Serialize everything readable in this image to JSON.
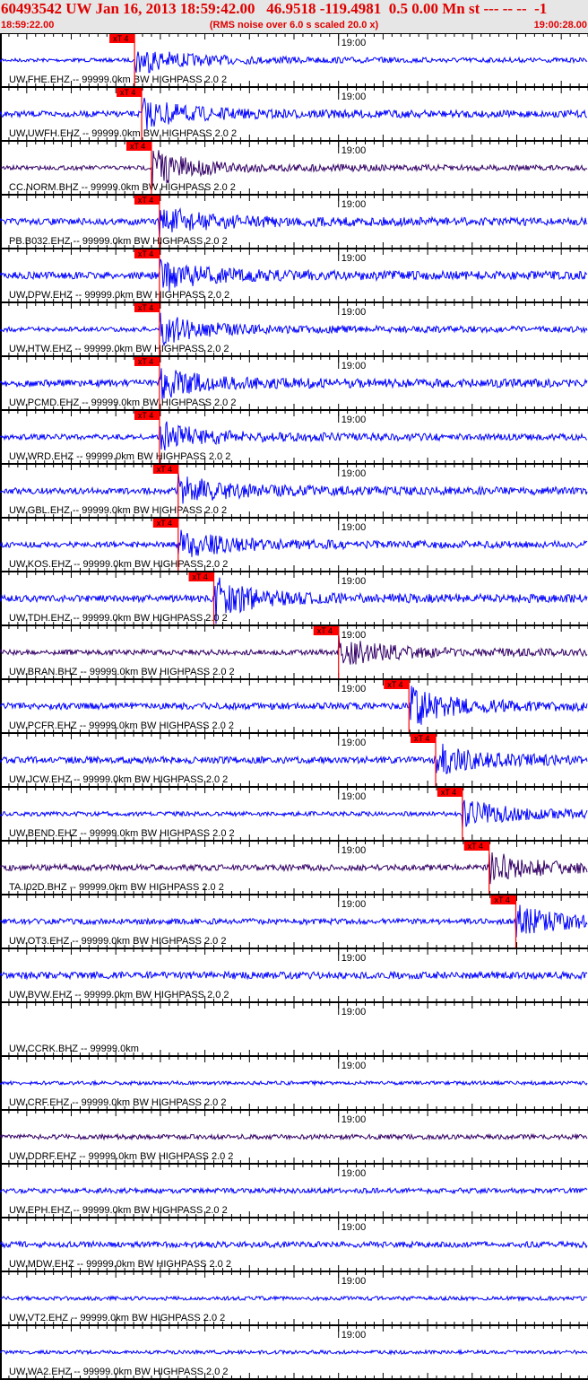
{
  "header": {
    "title": "60493542 UW Jan 16, 2013 18:59:42.00   46.9518 -119.4981  0.5 0.00 Mn st --- -- --  -1",
    "start_time": "18:59:22.00",
    "note": "(RMS noise over 6.0 s scaled 20.0 x)",
    "end_time": "19:00:28.00"
  },
  "chart_data": {
    "type": "line",
    "time_range_s": [
      0,
      66
    ],
    "tick_label": "19:00",
    "tick_label_time_s": 38,
    "pick_label": "xT 4",
    "colors": {
      "trace": "#0000ff",
      "trace_dark": "#330066",
      "pick": "#ff0000",
      "text": "#e00000"
    },
    "traces": [
      {
        "label": "UW.FHE.EHZ -- 99999.0km BW  HIGHPASS  2.0  2",
        "pick_s": 15.1,
        "color": "#0000ff"
      },
      {
        "label": "UW.UWFH.EHZ -- 99999.0km BW  HIGHPASS  2.0  2",
        "pick_s": 15.9,
        "color": "#0000ff"
      },
      {
        "label": "CC.NORM.BHZ -- 99999.0km BW  HIGHPASS  2.0  2",
        "pick_s": 17.0,
        "color": "#330066"
      },
      {
        "label": "PB.B032.EHZ -- 99999.0km BW  HIGHPASS  2.0  2",
        "pick_s": 17.9,
        "color": "#0000ff"
      },
      {
        "label": "UW.DPW.EHZ -- 99999.0km BW  HIGHPASS  2.0  2",
        "pick_s": 17.9,
        "color": "#0000ff"
      },
      {
        "label": "UW.HTW.EHZ -- 99999.0km BW  HIGHPASS  2.0  2",
        "pick_s": 17.9,
        "color": "#0000ff"
      },
      {
        "label": "UW.PCMD.EHZ -- 99999.0km BW  HIGHPASS  2.0  2",
        "pick_s": 17.9,
        "color": "#0000ff"
      },
      {
        "label": "UW.WRD.EHZ -- 99999.0km BW  HIGHPASS  2.0  2",
        "pick_s": 17.9,
        "color": "#0000ff"
      },
      {
        "label": "UW.GBL.EHZ -- 99999.0km BW  HIGHPASS  2.0  2",
        "pick_s": 20.0,
        "color": "#0000ff"
      },
      {
        "label": "UW.KOS.EHZ -- 99999.0km BW  HIGHPASS  2.0  2",
        "pick_s": 20.0,
        "color": "#0000ff"
      },
      {
        "label": "UW.TDH.EHZ -- 99999.0km BW  HIGHPASS  2.0  2",
        "pick_s": 24.0,
        "color": "#0000ff"
      },
      {
        "label": "UW.BRAN.BHZ -- 99999.0km BW  HIGHPASS  2.0  2",
        "pick_s": 38.0,
        "color": "#330066"
      },
      {
        "label": "UW.PCFR.EHZ -- 99999.0km BW  HIGHPASS  2.0  2",
        "pick_s": 45.9,
        "color": "#0000ff"
      },
      {
        "label": "UW.JCW.EHZ -- 99999.0km BW  HIGHPASS  2.0  2",
        "pick_s": 48.9,
        "color": "#0000ff"
      },
      {
        "label": "UW.BEND.EHZ -- 99999.0km BW  HIGHPASS  2.0  2",
        "pick_s": 51.9,
        "color": "#0000ff"
      },
      {
        "label": "TA.I02D.BHZ -- 99999.0km BW  HIGHPASS  2.0  2",
        "pick_s": 54.9,
        "color": "#330066"
      },
      {
        "label": "UW.OT3.EHZ -- 99999.0km BW  HIGHPASS  2.0  2",
        "pick_s": 57.9,
        "color": "#0000ff"
      },
      {
        "label": "UW.BVW.EHZ -- 99999.0km BW  HIGHPASS  2.0  2",
        "pick_s": null,
        "color": "#0000ff"
      },
      {
        "label": "UW.CCRK.BHZ -- 99999.0km",
        "pick_s": null,
        "color": null
      },
      {
        "label": "UW.CRF.EHZ -- 99999.0km BW  HIGHPASS  2.0  2",
        "pick_s": null,
        "color": "#0000ff"
      },
      {
        "label": "UW.DDRF.EHZ -- 99999.0km BW  HIGHPASS  2.0  2",
        "pick_s": null,
        "color": "#330066"
      },
      {
        "label": "UW.EPH.EHZ -- 99999.0km BW  HIGHPASS  2.0  2",
        "pick_s": null,
        "color": "#0000ff"
      },
      {
        "label": "UW.MDW.EHZ -- 99999.0km BW  HIGHPASS  2.0  2",
        "pick_s": null,
        "color": "#0000ff"
      },
      {
        "label": "UW.VT2.EHZ -- 99999.0km BW  HIGHPASS  2.0  2",
        "pick_s": null,
        "color": "#0000ff"
      },
      {
        "label": "UW.WA2.EHZ -- 99999.0km BW  HIGHPASS  2.0  2",
        "pick_s": null,
        "color": "#0000ff"
      }
    ]
  }
}
